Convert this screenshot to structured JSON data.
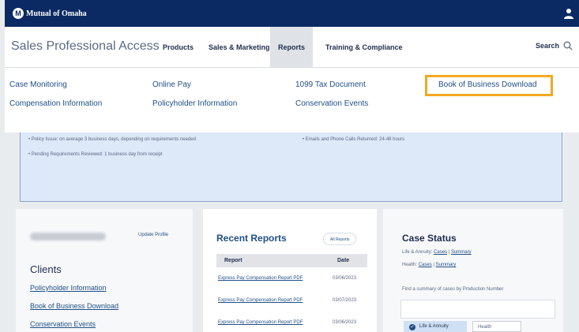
{
  "header": {
    "logo_text": "Mutual of Omaha",
    "logo_mark": "M",
    "user_icon": "user-icon"
  },
  "nav": {
    "brand": "Sales Professional Access",
    "items": [
      {
        "label": "Products"
      },
      {
        "label": "Sales & Marketing"
      },
      {
        "label": "Reports",
        "active": true
      },
      {
        "label": "Training & Compliance"
      }
    ],
    "search_label": "Search",
    "search_icon": "search-icon"
  },
  "dropdown": {
    "col1": [
      "Case Monitoring",
      "Compensation Information"
    ],
    "col2": [
      "Online Pay",
      "Policyholder Information"
    ],
    "col3": [
      "1099 Tax Document",
      "Conservation Events"
    ],
    "col4": [
      "Book of Business Download"
    ]
  },
  "info": {
    "lines": [
      "Policy Issue: on average 3 business days, depending on requirements needed",
      "Emails and Phone Calls Returned: 24-48 hours",
      "Pending Requirements Reviewed: 1 business day from receipt"
    ]
  },
  "clients_card": {
    "update_profile": "Update Profile",
    "title": "Clients",
    "links": [
      "Policyholder Information",
      "Book of Business Download",
      "Conservation Events"
    ]
  },
  "recent_reports": {
    "title": "Recent Reports",
    "all_reports": "All Reports",
    "columns": [
      "Report",
      "Date"
    ],
    "rows": [
      {
        "report": "Express Pay Compensation Report PDF",
        "date": "03/06/2023"
      },
      {
        "report": "Express Pay Compensation Report PDF",
        "date": "03/07/2023"
      },
      {
        "report": "Express Pay Compensation Report PDF",
        "date": "03/06/2023"
      }
    ]
  },
  "case_status": {
    "title": "Case Status",
    "life_label": "Life & Annuity:",
    "health_label": "Health:",
    "cases": "Cases",
    "summary": "Summary",
    "find_text": "Find a summary of cases by Production Number",
    "tab_life": "Life & Annuity",
    "tab_health": "Health"
  },
  "colors": {
    "navy": "#0b2a63",
    "link": "#1f4f86",
    "highlight": "#f2a91f",
    "info_bg": "#dde8f8"
  }
}
